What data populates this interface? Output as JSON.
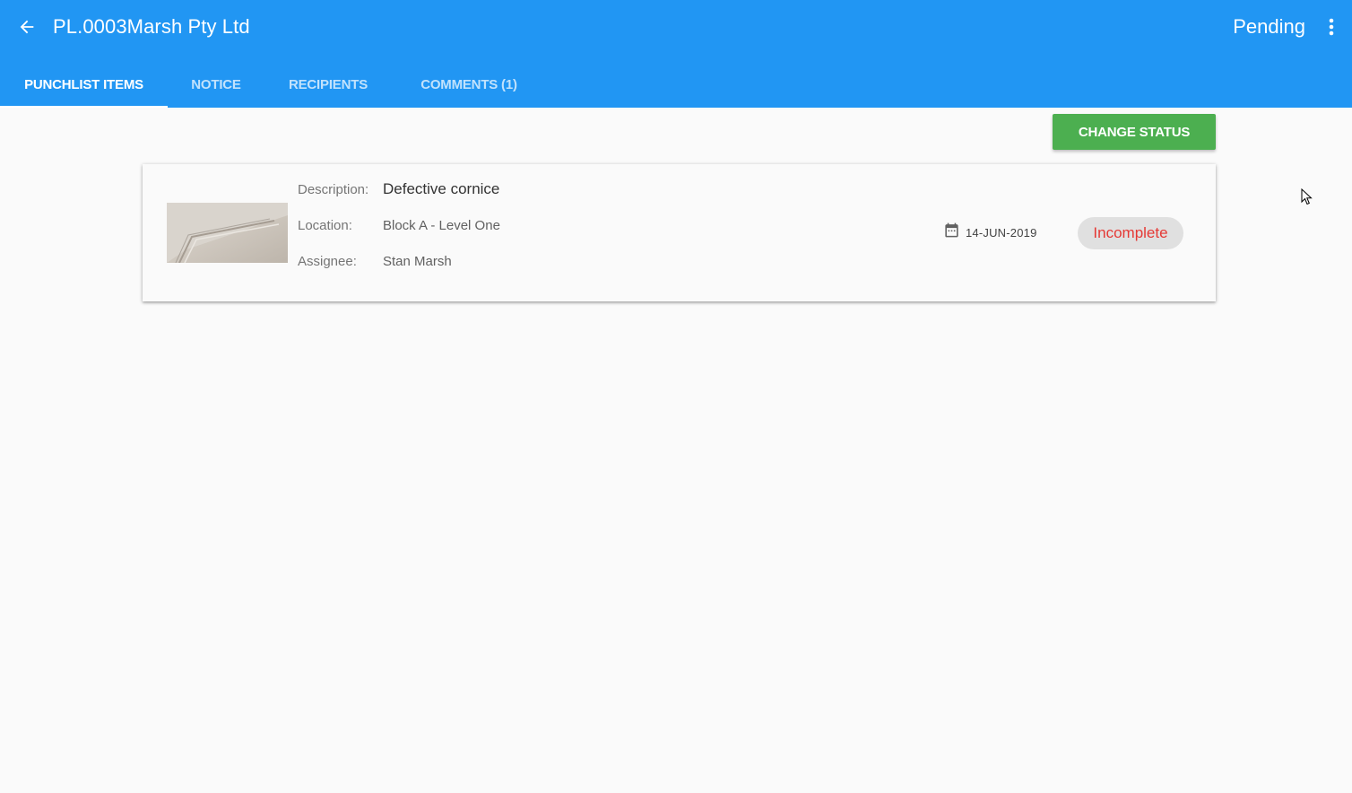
{
  "header": {
    "title": "PL.0003Marsh Pty Ltd",
    "status": "Pending",
    "back_icon": "arrow-back-icon",
    "more_icon": "more-vert-icon",
    "color": "#2196f3"
  },
  "tabs": [
    {
      "label": "PUNCHLIST ITEMS",
      "active": true
    },
    {
      "label": "NOTICE",
      "active": false
    },
    {
      "label": "RECIPIENTS",
      "active": false
    },
    {
      "label": "COMMENTS (1)",
      "active": false
    }
  ],
  "actions": {
    "change_status_label": "CHANGE STATUS",
    "change_status_color": "#4caf50"
  },
  "item": {
    "description_label": "Description:",
    "description": "Defective cornice",
    "location_label": "Location:",
    "location": "Block A - Level One",
    "assignee_label": "Assignee:",
    "assignee": "Stan Marsh",
    "date": "14-JUN-2019",
    "date_icon": "calendar-icon",
    "status": "Incomplete",
    "status_color": "#e53935"
  }
}
